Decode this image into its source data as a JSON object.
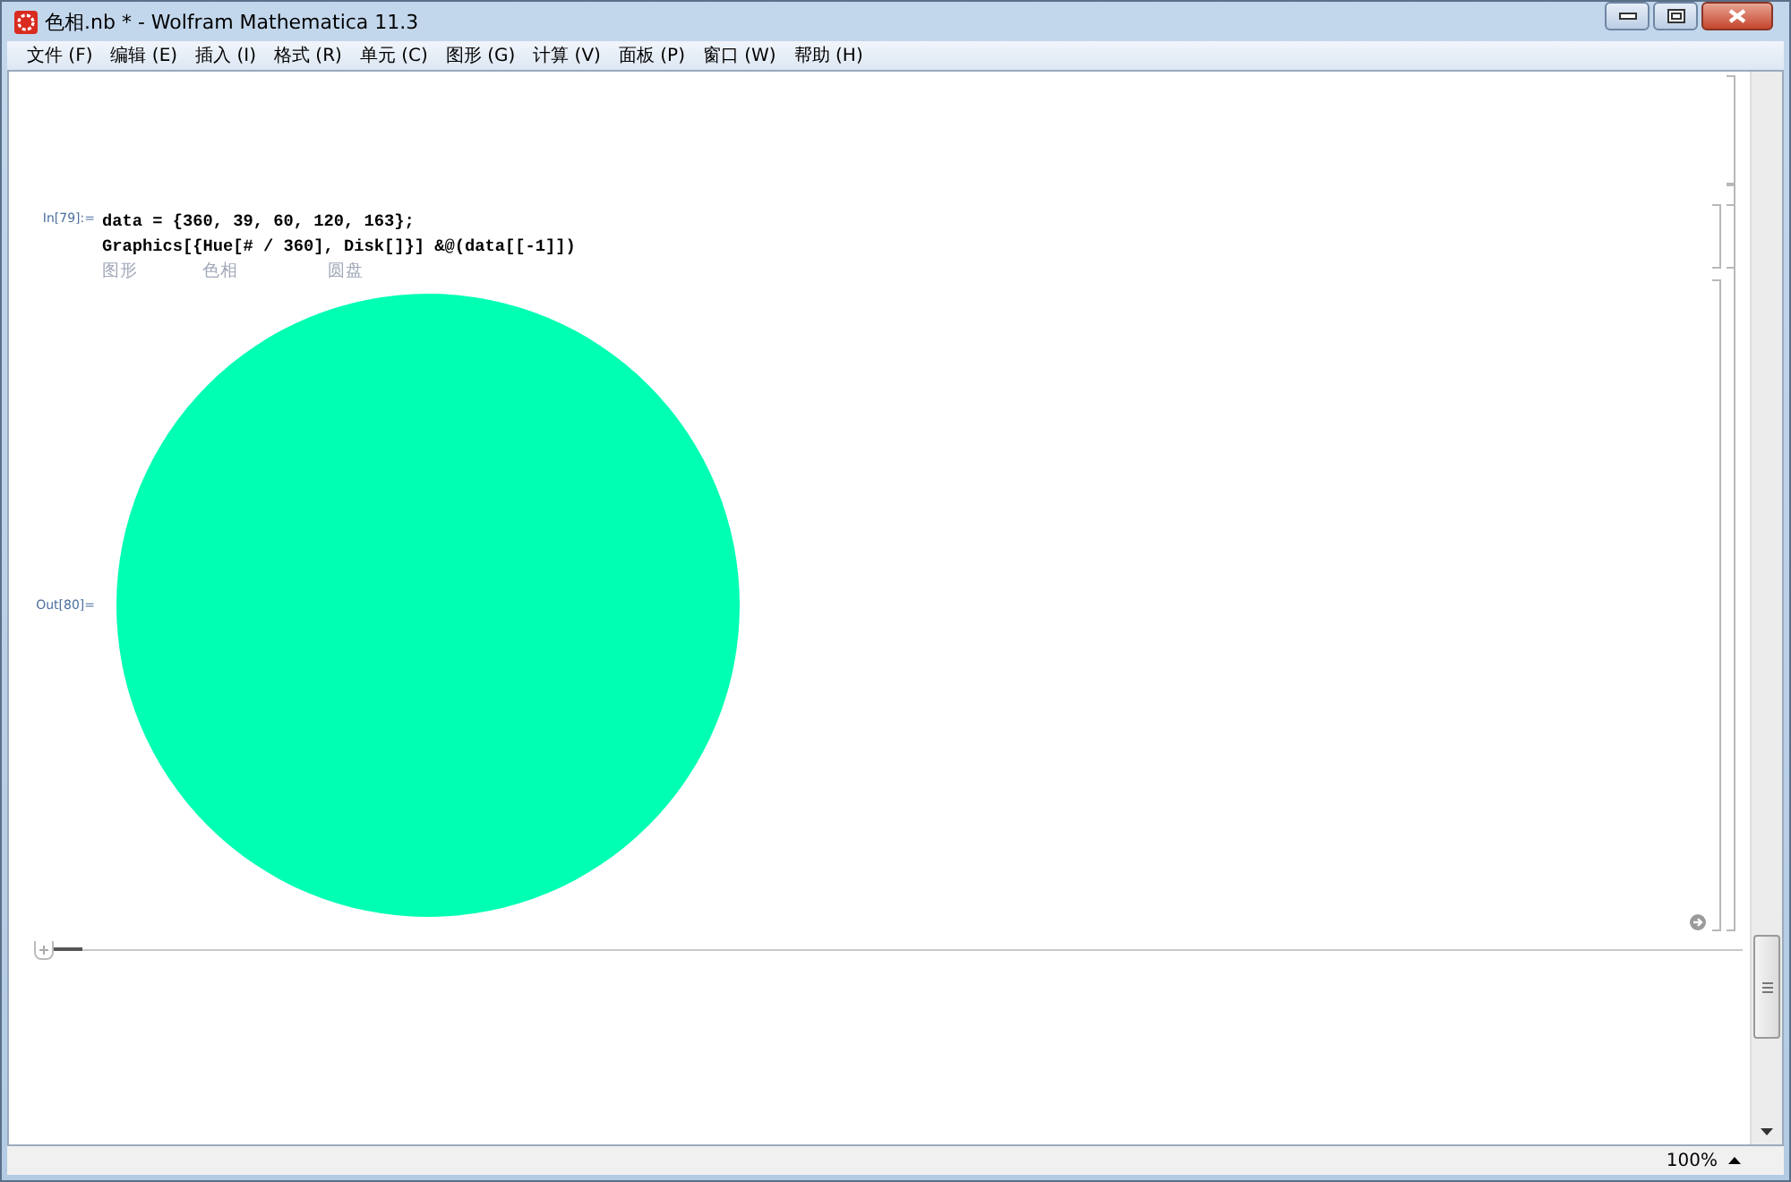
{
  "window": {
    "title": "色相.nb * - Wolfram Mathematica 11.3"
  },
  "menu": [
    "文件 (F)",
    "编辑 (E)",
    "插入 (I)",
    "格式 (R)",
    "单元 (C)",
    "图形 (G)",
    "计算 (V)",
    "面板 (P)",
    "窗口 (W)",
    "帮助 (H)"
  ],
  "cells": [
    {
      "kind": "input",
      "label": "In[79]:=",
      "lines": [
        "data = {360, 39, 60, 120, 163};",
        "Graphics[{Hue[# / 360], Disk[]}] &@(data[[-1]])"
      ],
      "hints": [
        "图形",
        "色相",
        "圆盘"
      ]
    },
    {
      "kind": "output",
      "label": "Out[80]="
    }
  ],
  "status_bar": {
    "zoom": "100%"
  }
}
